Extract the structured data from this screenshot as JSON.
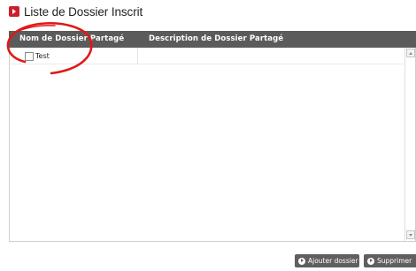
{
  "title": "Liste de Dossier Inscrit",
  "table": {
    "columns": [
      "Nom de Dossier Partagé",
      "Description de Dossier Partagé"
    ],
    "rows": [
      {
        "name": "Test",
        "description": "",
        "checked": false
      }
    ]
  },
  "buttons": {
    "add_label": "Ajouter dossier",
    "delete_label": "Supprimer"
  },
  "colors": {
    "title_icon": "#c8202c",
    "header_bg": "#5b5b5b",
    "button_bg": "#5f5f5f",
    "annotation": "#e01818"
  }
}
